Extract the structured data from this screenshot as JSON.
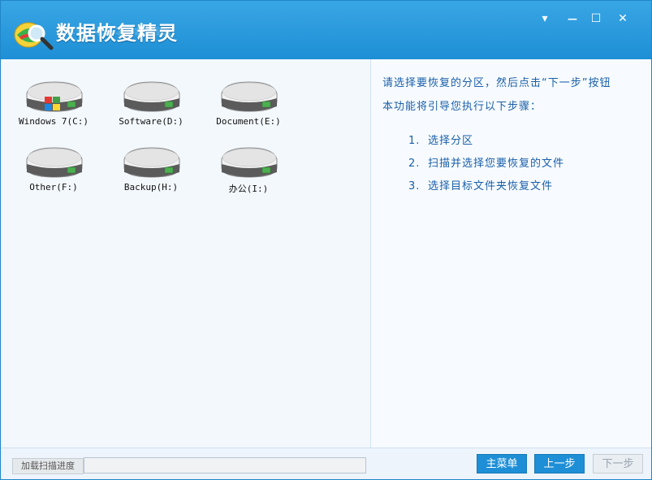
{
  "app": {
    "title": "数据恢复精灵"
  },
  "window_controls": {
    "menu": "▾",
    "minimize": "—",
    "maximize": "☐",
    "close": "✕"
  },
  "drives": [
    {
      "label": "Windows 7(C:)",
      "system": true
    },
    {
      "label": "Software(D:)",
      "system": false
    },
    {
      "label": "Document(E:)",
      "system": false
    },
    {
      "label": "Other(F:)",
      "system": false
    },
    {
      "label": "Backup(H:)",
      "system": false
    },
    {
      "label": "办公(I:)",
      "system": false
    }
  ],
  "instructions": {
    "line1": "请选择要恢复的分区，然后点击“下一步”按钮",
    "line2": "本功能将引导您执行以下步骤：",
    "steps": [
      {
        "num": "1.",
        "text": "选择分区"
      },
      {
        "num": "2.",
        "text": "扫描并选择您要恢复的文件"
      },
      {
        "num": "3.",
        "text": "选择目标文件夹恢复文件"
      }
    ]
  },
  "footer": {
    "progress_label": "加载扫描进度",
    "progress": 0,
    "main_menu": "主菜单",
    "prev": "上一步",
    "next": "下一步"
  },
  "colors": {
    "titlebar": "#1e8fd6",
    "accent": "#1a5fa8",
    "button": "#1e8fd6"
  }
}
